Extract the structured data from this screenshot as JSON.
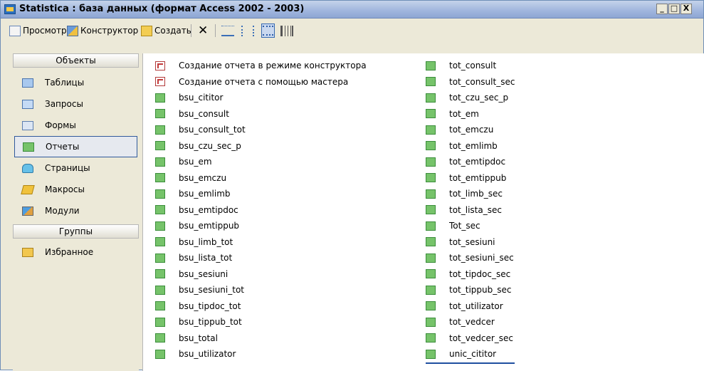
{
  "window": {
    "title": "Statistica : база данных (формат Access 2002 - 2003)",
    "controls": [
      "_",
      "□",
      "X"
    ]
  },
  "toolbar": {
    "view_label": "Просмотр",
    "design_label": "Конструктор",
    "create_label": "Создать",
    "delete_glyph": "✕"
  },
  "sidebar": {
    "objects_header": "Объекты",
    "items": [
      {
        "label": "Таблицы",
        "icon": "table-icon"
      },
      {
        "label": "Запросы",
        "icon": "query-icon"
      },
      {
        "label": "Формы",
        "icon": "form-icon"
      },
      {
        "label": "Отчеты",
        "icon": "report-icon",
        "selected": true
      },
      {
        "label": "Страницы",
        "icon": "page-icon"
      },
      {
        "label": "Макросы",
        "icon": "macro-icon"
      },
      {
        "label": "Модули",
        "icon": "module-icon"
      }
    ],
    "groups_header": "Группы",
    "groups": [
      {
        "label": "Избранное",
        "icon": "favorites-folder-icon"
      }
    ]
  },
  "reports": {
    "column1": [
      {
        "label": "Создание отчета в режиме конструктора",
        "icon": "wizard-icon"
      },
      {
        "label": "Создание отчета с помощью мастера",
        "icon": "wizard-icon"
      },
      {
        "label": "bsu_cititor",
        "icon": "report-icon"
      },
      {
        "label": "bsu_consult",
        "icon": "report-icon"
      },
      {
        "label": "bsu_consult_tot",
        "icon": "report-icon"
      },
      {
        "label": "bsu_czu_sec_p",
        "icon": "report-icon"
      },
      {
        "label": "bsu_em",
        "icon": "report-icon"
      },
      {
        "label": "bsu_emczu",
        "icon": "report-icon"
      },
      {
        "label": "bsu_emlimb",
        "icon": "report-icon"
      },
      {
        "label": "bsu_emtipdoc",
        "icon": "report-icon"
      },
      {
        "label": "bsu_emtippub",
        "icon": "report-icon"
      },
      {
        "label": "bsu_limb_tot",
        "icon": "report-icon"
      },
      {
        "label": "bsu_lista_tot",
        "icon": "report-icon"
      },
      {
        "label": "bsu_sesiuni",
        "icon": "report-icon"
      },
      {
        "label": "bsu_sesiuni_tot",
        "icon": "report-icon"
      },
      {
        "label": "bsu_tipdoc_tot",
        "icon": "report-icon"
      },
      {
        "label": "bsu_tippub_tot",
        "icon": "report-icon"
      },
      {
        "label": "bsu_total",
        "icon": "report-icon"
      },
      {
        "label": "bsu_utilizator",
        "icon": "report-icon"
      }
    ],
    "column2": [
      {
        "label": "tot_consult",
        "icon": "report-icon"
      },
      {
        "label": "tot_consult_sec",
        "icon": "report-icon"
      },
      {
        "label": "tot_czu_sec_p",
        "icon": "report-icon"
      },
      {
        "label": "tot_em",
        "icon": "report-icon"
      },
      {
        "label": "tot_emczu",
        "icon": "report-icon"
      },
      {
        "label": "tot_emlimb",
        "icon": "report-icon"
      },
      {
        "label": "tot_emtipdoc",
        "icon": "report-icon"
      },
      {
        "label": "tot_emtippub",
        "icon": "report-icon"
      },
      {
        "label": "tot_limb_sec",
        "icon": "report-icon"
      },
      {
        "label": "tot_lista_sec",
        "icon": "report-icon"
      },
      {
        "label": "Tot_sec",
        "icon": "report-icon"
      },
      {
        "label": "tot_sesiuni",
        "icon": "report-icon"
      },
      {
        "label": "tot_sesiuni_sec",
        "icon": "report-icon"
      },
      {
        "label": "tot_tipdoc_sec",
        "icon": "report-icon"
      },
      {
        "label": "tot_tippub_sec",
        "icon": "report-icon"
      },
      {
        "label": "tot_utilizator",
        "icon": "report-icon"
      },
      {
        "label": "tot_vedcer",
        "icon": "report-icon"
      },
      {
        "label": "tot_vedcer_sec",
        "icon": "report-icon"
      },
      {
        "label": "unic_cititor",
        "icon": "report-icon",
        "selected": true
      }
    ]
  }
}
